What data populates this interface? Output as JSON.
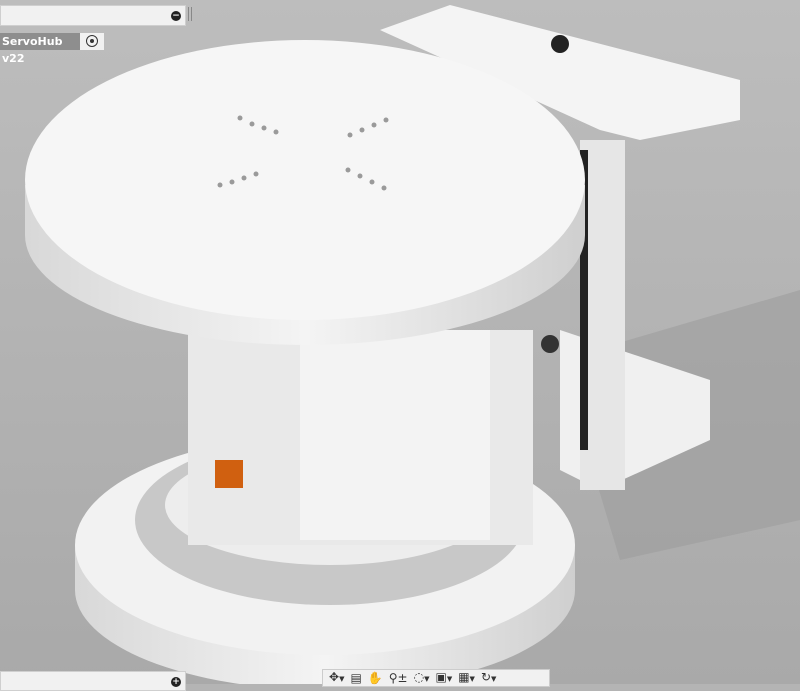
{
  "document": {
    "name": "ServoHub v22"
  },
  "panels": {
    "browser_icon": "collapse-minus-icon",
    "comments_icon": "expand-plus-icon"
  },
  "toolbar": {
    "items": [
      "orbit-icon",
      "look-at-icon",
      "pan-icon",
      "zoom-icon",
      "fit-icon",
      "display-settings-icon",
      "grid-settings-icon",
      "viewports-icon"
    ]
  }
}
